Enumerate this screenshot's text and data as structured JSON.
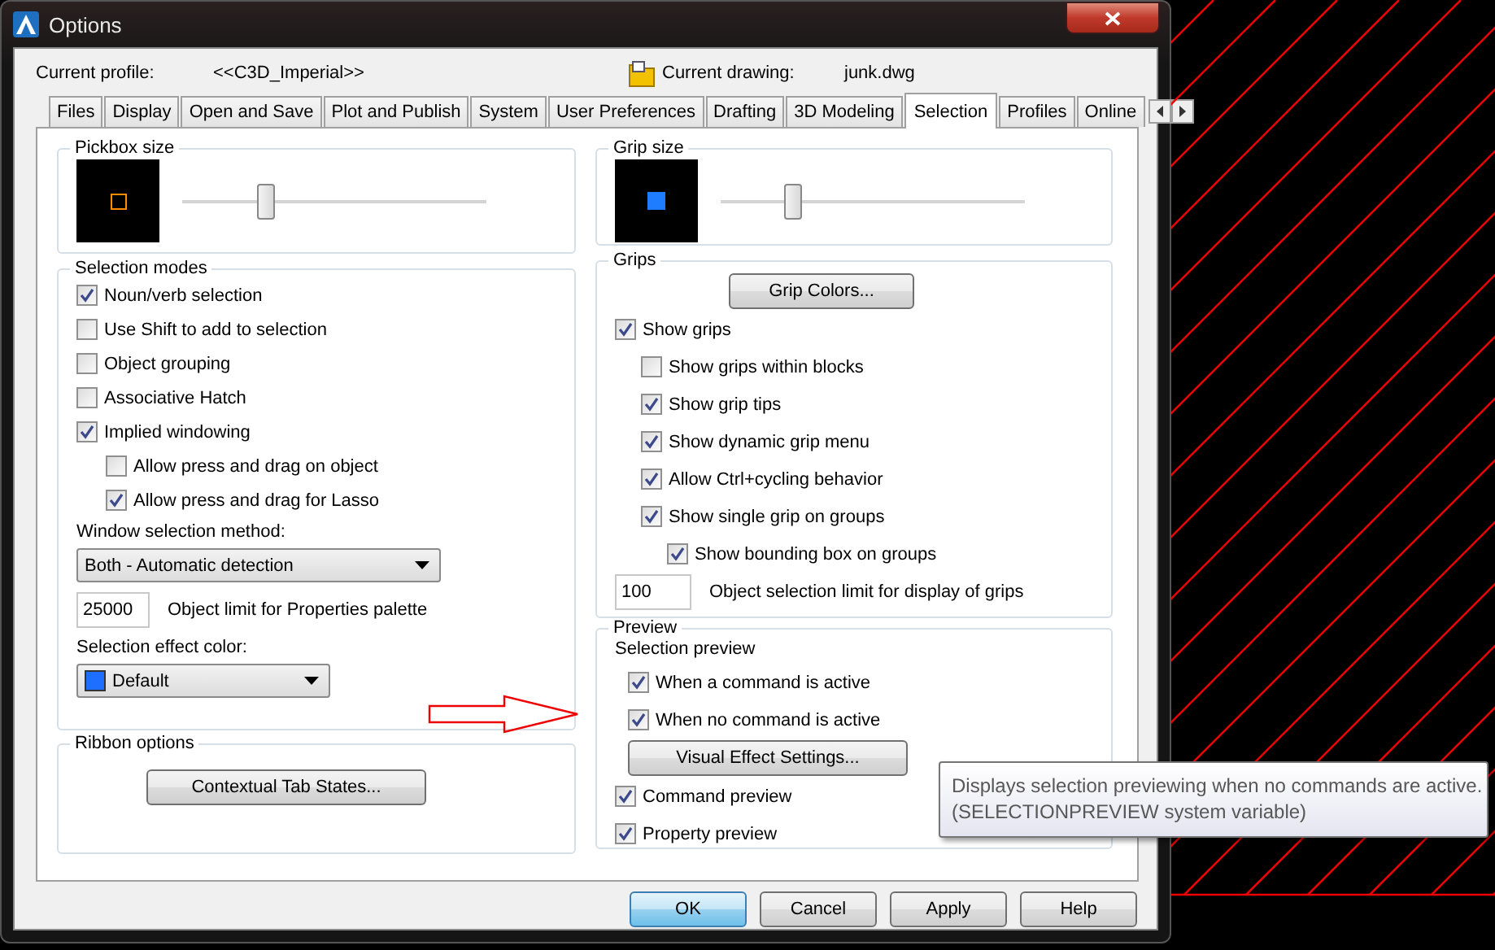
{
  "window": {
    "title": "Options"
  },
  "profile": {
    "label": "Current profile:",
    "value": "<<C3D_Imperial>>"
  },
  "drawing": {
    "label": "Current drawing:",
    "value": "junk.dwg"
  },
  "tabs": [
    {
      "label": "Files",
      "selected": false
    },
    {
      "label": "Display",
      "selected": false
    },
    {
      "label": "Open and Save",
      "selected": false
    },
    {
      "label": "Plot and Publish",
      "selected": false
    },
    {
      "label": "System",
      "selected": false
    },
    {
      "label": "User Preferences",
      "selected": false
    },
    {
      "label": "Drafting",
      "selected": false
    },
    {
      "label": "3D Modeling",
      "selected": false
    },
    {
      "label": "Selection",
      "selected": true
    },
    {
      "label": "Profiles",
      "selected": false
    },
    {
      "label": "Online",
      "selected": false
    }
  ],
  "pickbox": {
    "title": "Pickbox size",
    "level": 0.26
  },
  "selection_modes": {
    "title": "Selection modes",
    "options": [
      {
        "label": "Noun/verb selection",
        "checked": true
      },
      {
        "label": "Use Shift to add to selection",
        "checked": false
      },
      {
        "label": "Object grouping",
        "checked": false
      },
      {
        "label": "Associative Hatch",
        "checked": false
      },
      {
        "label": "Implied windowing",
        "checked": true,
        "children": [
          {
            "label": "Allow press and drag on object",
            "checked": false
          },
          {
            "label": "Allow press and drag for Lasso",
            "checked": true
          }
        ]
      }
    ],
    "window_method": {
      "label": "Window selection method:",
      "value": "Both - Automatic detection"
    },
    "object_limit": {
      "value": "25000",
      "label": "Object limit for Properties palette"
    },
    "effect_color": {
      "label": "Selection effect color:",
      "value": "Default"
    }
  },
  "ribbon_options": {
    "title": "Ribbon options",
    "button": "Contextual Tab States..."
  },
  "grip_size": {
    "title": "Grip size",
    "level": 0.22
  },
  "grips": {
    "title": "Grips",
    "button": "Grip Colors...",
    "options": [
      {
        "label": "Show grips",
        "checked": true,
        "children": [
          {
            "label": "Show grips within blocks",
            "checked": false
          },
          {
            "label": "Show grip tips",
            "checked": true
          },
          {
            "label": "Show dynamic grip menu",
            "checked": true
          },
          {
            "label": "Allow Ctrl+cycling behavior",
            "checked": true
          },
          {
            "label": "Show single grip on groups",
            "checked": true,
            "children": [
              {
                "label": "Show bounding box on groups",
                "checked": true
              }
            ]
          }
        ]
      }
    ],
    "selection_limit": {
      "value": "100",
      "label": "Object selection limit for display of grips"
    }
  },
  "preview": {
    "title": "Preview",
    "subtitle": "Selection preview",
    "selection_options": [
      {
        "label": "When a command is active",
        "checked": true
      },
      {
        "label": "When no command is active",
        "checked": true
      }
    ],
    "button": "Visual Effect Settings...",
    "options": [
      {
        "label": "Command preview",
        "checked": true
      },
      {
        "label": "Property preview",
        "checked": true
      }
    ]
  },
  "tooltip": {
    "lines": [
      "Displays selection previewing when no commands are active.",
      "(SELECTIONPREVIEW system variable)"
    ]
  },
  "buttons": [
    {
      "label": "OK",
      "default": true
    },
    {
      "label": "Cancel",
      "default": false
    },
    {
      "label": "Apply",
      "default": false
    },
    {
      "label": "Help",
      "default": false
    }
  ]
}
